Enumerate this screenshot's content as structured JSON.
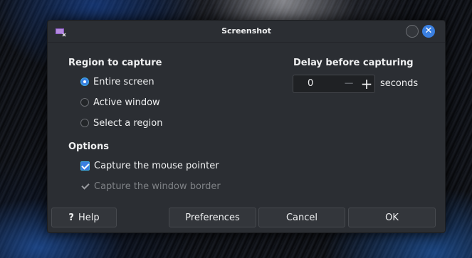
{
  "window": {
    "title": "Screenshot",
    "close_glyph": "✕"
  },
  "region": {
    "heading": "Region to capture",
    "options": [
      {
        "label": "Entire screen",
        "selected": true
      },
      {
        "label": "Active window",
        "selected": false
      },
      {
        "label": "Select a region",
        "selected": false
      }
    ]
  },
  "options": {
    "heading": "Options",
    "items": [
      {
        "label": "Capture the mouse pointer",
        "checked": true,
        "enabled": true
      },
      {
        "label": "Capture the window border",
        "checked": true,
        "enabled": false
      }
    ]
  },
  "delay": {
    "heading": "Delay before capturing",
    "value": "0",
    "minus": "−",
    "plus": "+",
    "unit": "seconds"
  },
  "buttons": {
    "help_glyph": "?",
    "help": "Help",
    "preferences": "Preferences",
    "cancel": "Cancel",
    "ok": "OK"
  },
  "colors": {
    "accent": "#3a7fe0",
    "window_bg": "#2b2e33",
    "text": "#eff0f1"
  }
}
